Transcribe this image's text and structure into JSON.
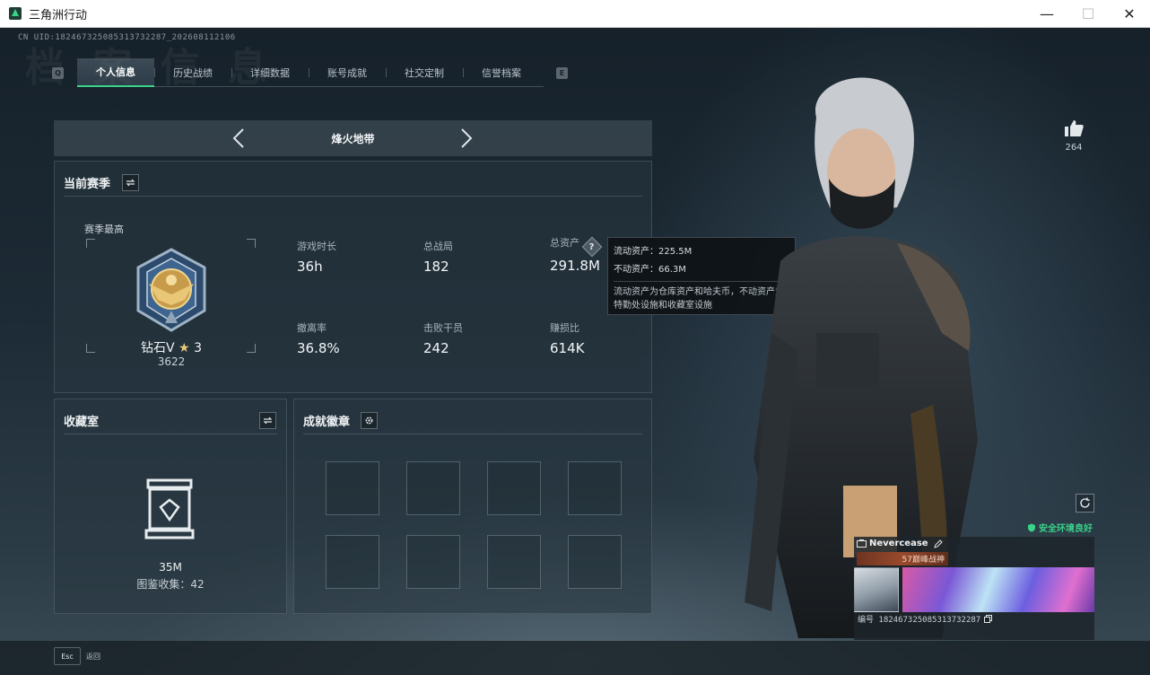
{
  "window": {
    "title": "三角洲行动",
    "controls": [
      "—",
      "☐",
      "✕"
    ]
  },
  "uid_text": "CN UID:182467325085313732287_202608112106",
  "key_hints": {
    "left": "Q",
    "right": "E"
  },
  "tabs": [
    {
      "label": "个人信息",
      "active": true
    },
    {
      "label": "历史战绩",
      "active": false
    },
    {
      "label": "详细数据",
      "active": false
    },
    {
      "label": "账号成就",
      "active": false
    },
    {
      "label": "社交定制",
      "active": false
    },
    {
      "label": "信誉档案",
      "active": false
    }
  ],
  "mode": {
    "title": "烽火地带"
  },
  "season": {
    "title": "当前赛季",
    "highest_label": "赛季最高",
    "rank_name": "钻石V",
    "rank_stars": "3",
    "rank_score": "3622",
    "stats": [
      {
        "label": "游戏时长",
        "value": "36h"
      },
      {
        "label": "总战局",
        "value": "182"
      },
      {
        "label": "总资产",
        "value": "291.8M",
        "has_help": true
      },
      {
        "label": "撤离率",
        "value": "36.8%"
      },
      {
        "label": "击败干员",
        "value": "242"
      },
      {
        "label": "赚损比",
        "value": "614K"
      }
    ]
  },
  "tooltip": {
    "liquid": "流动资产：225.5M",
    "fixed": "不动资产：66.3M",
    "desc": "流动资产为仓库资产和哈夫币，不动资产为特勤处设施和收藏室设施"
  },
  "collection": {
    "title": "收藏室",
    "value": "35M",
    "count": "图鉴收集：42"
  },
  "achievements": {
    "title": "成就徽章"
  },
  "likes": {
    "count": "264"
  },
  "environment": {
    "status": "安全环境良好"
  },
  "player": {
    "name": "Nevercease",
    "title_badge": "57巅峰战神",
    "id": "编号 182467325085313732287"
  },
  "esc": {
    "key": "Esc",
    "label": "返回"
  },
  "colors": {
    "accent": "#3ad38a",
    "text": "#d6dde3"
  }
}
